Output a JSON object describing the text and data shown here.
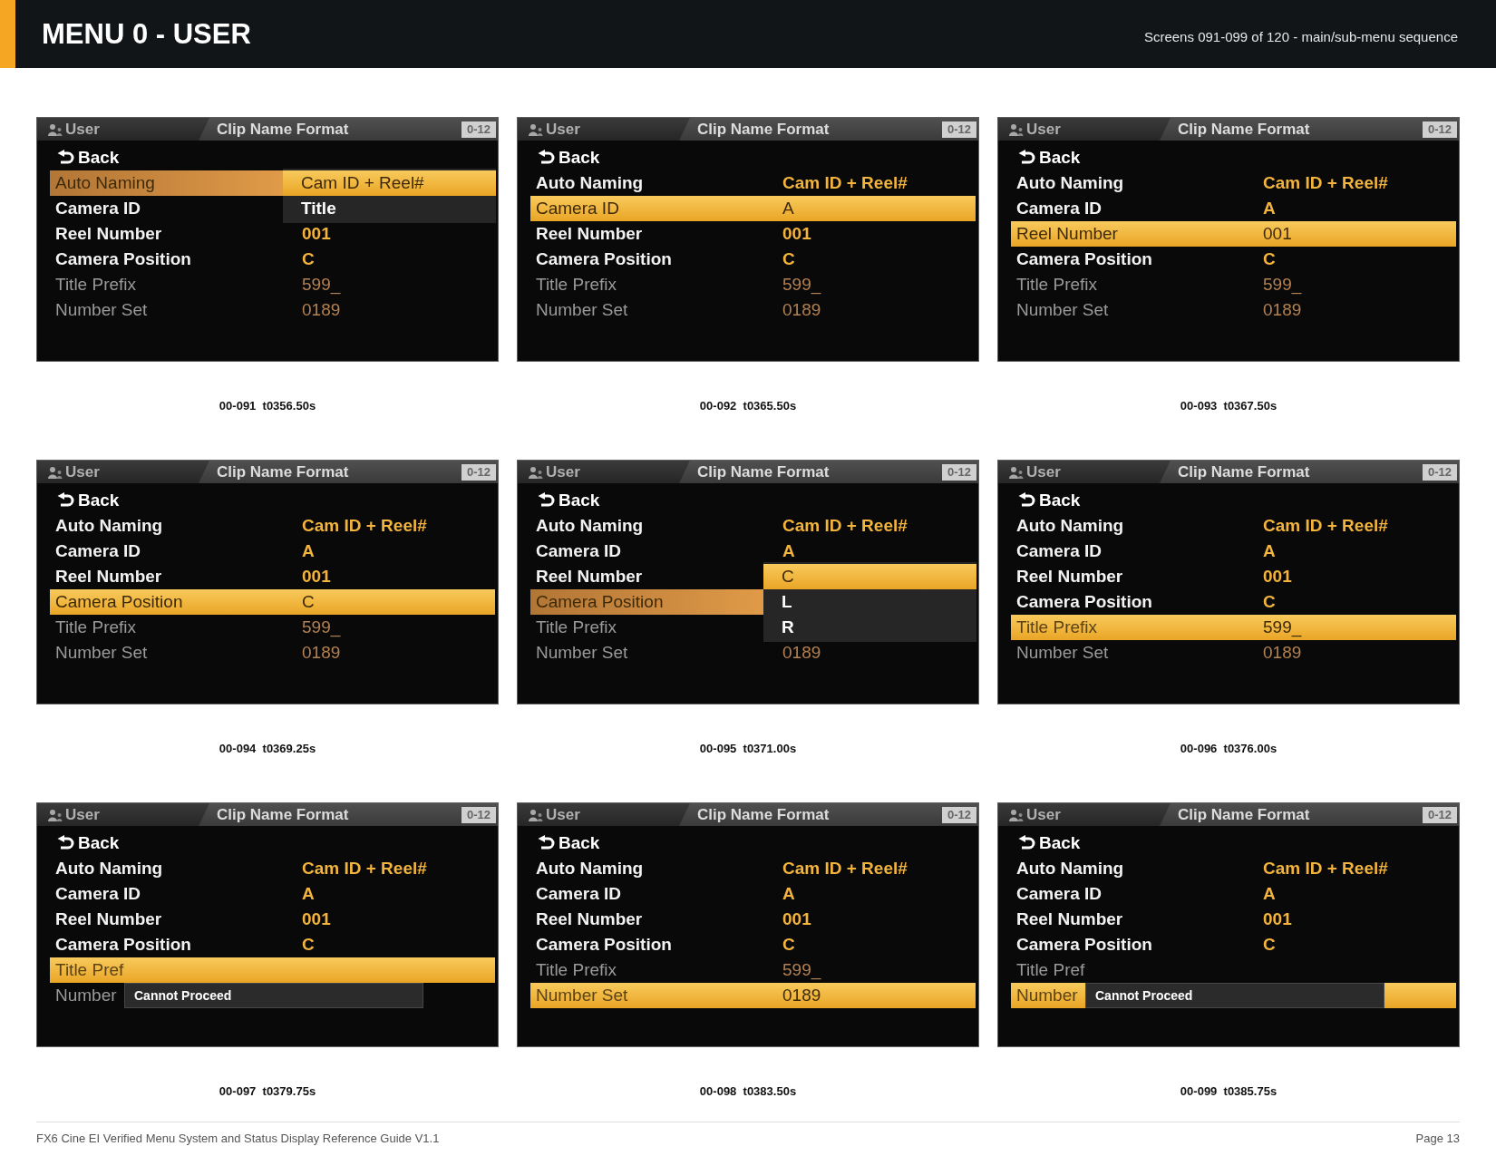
{
  "header": {
    "title": "MENU 0 - USER",
    "subtitle": "Screens 091-099 of 120 - main/sub-menu sequence"
  },
  "screens": [
    {
      "caption": "00-091  t0356.50s",
      "screen": {
        "breadcrumb": "User",
        "title": "Clip Name Format",
        "page": "0-12",
        "back": "Back",
        "rows": [
          {
            "label": "Auto Naming",
            "selected": true,
            "disabled": false,
            "dropdown": {
              "options": [
                {
                  "label": "Cam ID + Reel#",
                  "selected": true
                },
                {
                  "label": "Title",
                  "selected": false
                }
              ]
            }
          },
          {
            "label": "Camera ID",
            "selected": false,
            "disabled": false
          },
          {
            "label": "Reel Number",
            "value": "001",
            "selected": false,
            "disabled": false
          },
          {
            "label": "Camera Position",
            "value": "C",
            "selected": false,
            "disabled": false
          },
          {
            "label": "Title Prefix",
            "value": "599_",
            "selected": false,
            "disabled": true
          },
          {
            "label": "Number Set",
            "value": "0189",
            "selected": false,
            "disabled": true
          }
        ]
      }
    },
    {
      "caption": "00-092  t0365.50s",
      "screen": {
        "breadcrumb": "User",
        "title": "Clip Name Format",
        "page": "0-12",
        "back": "Back",
        "rows": [
          {
            "label": "Auto Naming",
            "value": "Cam ID + Reel#",
            "selected": false,
            "disabled": false
          },
          {
            "label": "Camera ID",
            "value": "A",
            "selected": true,
            "disabled": false
          },
          {
            "label": "Reel Number",
            "value": "001",
            "selected": false,
            "disabled": false
          },
          {
            "label": "Camera Position",
            "value": "C",
            "selected": false,
            "disabled": false
          },
          {
            "label": "Title Prefix",
            "value": "599_",
            "selected": false,
            "disabled": true
          },
          {
            "label": "Number Set",
            "value": "0189",
            "selected": false,
            "disabled": true
          }
        ]
      }
    },
    {
      "caption": "00-093  t0367.50s",
      "screen": {
        "breadcrumb": "User",
        "title": "Clip Name Format",
        "page": "0-12",
        "back": "Back",
        "rows": [
          {
            "label": "Auto Naming",
            "value": "Cam ID + Reel#",
            "selected": false,
            "disabled": false
          },
          {
            "label": "Camera ID",
            "value": "A",
            "selected": false,
            "disabled": false
          },
          {
            "label": "Reel Number",
            "value": "001",
            "selected": true,
            "disabled": false
          },
          {
            "label": "Camera Position",
            "value": "C",
            "selected": false,
            "disabled": false
          },
          {
            "label": "Title Prefix",
            "value": "599_",
            "selected": false,
            "disabled": true
          },
          {
            "label": "Number Set",
            "value": "0189",
            "selected": false,
            "disabled": true
          }
        ]
      }
    },
    {
      "caption": "00-094  t0369.25s",
      "screen": {
        "breadcrumb": "User",
        "title": "Clip Name Format",
        "page": "0-12",
        "back": "Back",
        "rows": [
          {
            "label": "Auto Naming",
            "value": "Cam ID + Reel#",
            "selected": false,
            "disabled": false
          },
          {
            "label": "Camera ID",
            "value": "A",
            "selected": false,
            "disabled": false
          },
          {
            "label": "Reel Number",
            "value": "001",
            "selected": false,
            "disabled": false
          },
          {
            "label": "Camera Position",
            "value": "C",
            "selected": true,
            "disabled": false
          },
          {
            "label": "Title Prefix",
            "value": "599_",
            "selected": false,
            "disabled": true
          },
          {
            "label": "Number Set",
            "value": "0189",
            "selected": false,
            "disabled": true
          }
        ]
      }
    },
    {
      "caption": "00-095  t0371.00s",
      "screen": {
        "breadcrumb": "User",
        "title": "Clip Name Format",
        "page": "0-12",
        "back": "Back",
        "rows": [
          {
            "label": "Auto Naming",
            "value": "Cam ID + Reel#",
            "selected": false,
            "disabled": false
          },
          {
            "label": "Camera ID",
            "value": "A",
            "selected": false,
            "disabled": false
          },
          {
            "label": "Reel Number",
            "selected": false,
            "disabled": false
          },
          {
            "label": "Camera Position",
            "selected": true,
            "disabled": false,
            "dropdown": {
              "options": [
                {
                  "label": "C",
                  "selected": true
                },
                {
                  "label": "L",
                  "selected": false
                },
                {
                  "label": "R",
                  "selected": false
                }
              ]
            }
          },
          {
            "label": "Title Prefix",
            "selected": false,
            "disabled": true
          },
          {
            "label": "Number Set",
            "value": "0189",
            "selected": false,
            "disabled": true
          }
        ]
      }
    },
    {
      "caption": "00-096  t0376.00s",
      "screen": {
        "breadcrumb": "User",
        "title": "Clip Name Format",
        "page": "0-12",
        "back": "Back",
        "rows": [
          {
            "label": "Auto Naming",
            "value": "Cam ID + Reel#",
            "selected": false,
            "disabled": false
          },
          {
            "label": "Camera ID",
            "value": "A",
            "selected": false,
            "disabled": false
          },
          {
            "label": "Reel Number",
            "value": "001",
            "selected": false,
            "disabled": false
          },
          {
            "label": "Camera Position",
            "value": "C",
            "selected": false,
            "disabled": false
          },
          {
            "label": "Title Prefix",
            "value": "599_",
            "selected": true,
            "disabled": true
          },
          {
            "label": "Number Set",
            "value": "0189",
            "selected": false,
            "disabled": true
          }
        ]
      }
    },
    {
      "caption": "00-097  t0379.75s",
      "screen": {
        "breadcrumb": "User",
        "title": "Clip Name Format",
        "page": "0-12",
        "back": "Back",
        "rows": [
          {
            "label": "Auto Naming",
            "value": "Cam ID + Reel#",
            "selected": false,
            "disabled": false
          },
          {
            "label": "Camera ID",
            "value": "A",
            "selected": false,
            "disabled": false
          },
          {
            "label": "Reel Number",
            "value": "001",
            "selected": false,
            "disabled": false
          },
          {
            "label": "Camera Position",
            "value": "C",
            "selected": false,
            "disabled": false
          },
          {
            "label": "Title Pref",
            "selected": true,
            "disabled": true
          },
          {
            "label": "Number",
            "selected": false,
            "disabled": true
          }
        ],
        "alert": {
          "text": "Cannot Proceed"
        }
      }
    },
    {
      "caption": "00-098  t0383.50s",
      "screen": {
        "breadcrumb": "User",
        "title": "Clip Name Format",
        "page": "0-12",
        "back": "Back",
        "rows": [
          {
            "label": "Auto Naming",
            "value": "Cam ID + Reel#",
            "selected": false,
            "disabled": false
          },
          {
            "label": "Camera ID",
            "value": "A",
            "selected": false,
            "disabled": false
          },
          {
            "label": "Reel Number",
            "value": "001",
            "selected": false,
            "disabled": false
          },
          {
            "label": "Camera Position",
            "value": "C",
            "selected": false,
            "disabled": false
          },
          {
            "label": "Title Prefix",
            "value": "599_",
            "selected": false,
            "disabled": true
          },
          {
            "label": "Number Set",
            "value": "0189",
            "selected": true,
            "disabled": true
          }
        ]
      }
    },
    {
      "caption": "00-099  t0385.75s",
      "screen": {
        "breadcrumb": "User",
        "title": "Clip Name Format",
        "page": "0-12",
        "back": "Back",
        "rows": [
          {
            "label": "Auto Naming",
            "value": "Cam ID + Reel#",
            "selected": false,
            "disabled": false
          },
          {
            "label": "Camera ID",
            "value": "A",
            "selected": false,
            "disabled": false
          },
          {
            "label": "Reel Number",
            "value": "001",
            "selected": false,
            "disabled": false
          },
          {
            "label": "Camera Position",
            "value": "C",
            "selected": false,
            "disabled": false
          },
          {
            "label": "Title Pref",
            "selected": false,
            "disabled": true
          },
          {
            "label": "Number",
            "selected": true,
            "disabled": true
          }
        ],
        "alert": {
          "text": "Cannot Proceed"
        }
      }
    }
  ],
  "footer": {
    "text": "FX6 Cine EI Verified Menu System and Status Display Reference Guide V1.1",
    "page": "Page 13"
  }
}
